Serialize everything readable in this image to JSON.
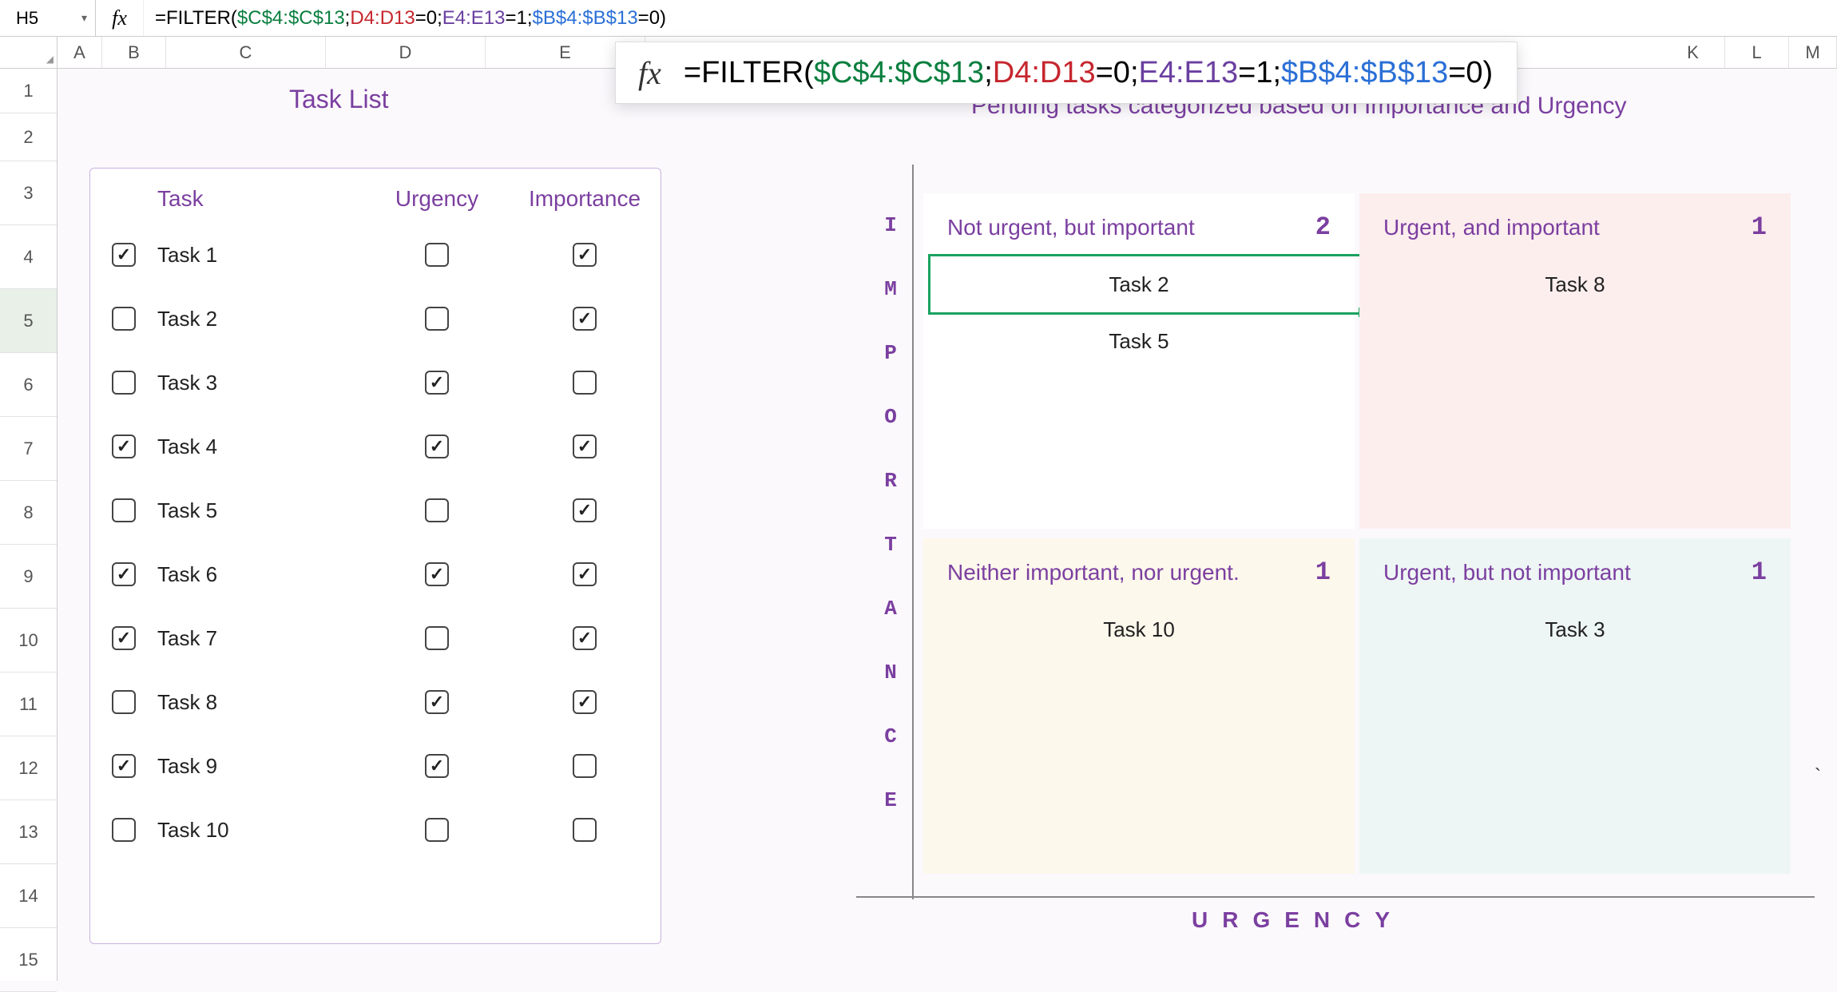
{
  "nameBox": "H5",
  "formulaBar": {
    "prefix": "=FILTER(",
    "r1": "$C$4:$C$13",
    "r2": "D4:D13",
    "v2": "=0",
    "r3": "E4:E13",
    "v3": "=1",
    "r4": "$B$4:$B$13",
    "v4": "=0)",
    "sep": ";"
  },
  "columns": [
    "A",
    "B",
    "C",
    "D",
    "E",
    "K",
    "L",
    "M"
  ],
  "rows": [
    "1",
    "2",
    "3",
    "4",
    "5",
    "6",
    "7",
    "8",
    "9",
    "10",
    "11",
    "12",
    "13",
    "14",
    "15"
  ],
  "selectedRow": "5",
  "taskList": {
    "title": "Task List",
    "headers": {
      "task": "Task",
      "urgency": "Urgency",
      "importance": "Importance"
    },
    "rows": [
      {
        "done": true,
        "name": "Task 1",
        "urgent": false,
        "important": true
      },
      {
        "done": false,
        "name": "Task 2",
        "urgent": false,
        "important": true
      },
      {
        "done": false,
        "name": "Task 3",
        "urgent": true,
        "important": false
      },
      {
        "done": true,
        "name": "Task 4",
        "urgent": true,
        "important": true
      },
      {
        "done": false,
        "name": "Task 5",
        "urgent": false,
        "important": true
      },
      {
        "done": true,
        "name": "Task 6",
        "urgent": true,
        "important": true
      },
      {
        "done": true,
        "name": "Task 7",
        "urgent": false,
        "important": true
      },
      {
        "done": false,
        "name": "Task 8",
        "urgent": true,
        "important": true
      },
      {
        "done": true,
        "name": "Task 9",
        "urgent": true,
        "important": false
      },
      {
        "done": false,
        "name": "Task 10",
        "urgent": false,
        "important": false
      }
    ]
  },
  "matrix": {
    "title": "Pending tasks categorized based on Importance and Urgency",
    "vAxis": [
      "I",
      "M",
      "P",
      "O",
      "R",
      "T",
      "A",
      "N",
      "C",
      "E"
    ],
    "hAxis": "URGENCY",
    "quads": {
      "q1": {
        "label": "Not urgent, but important",
        "count": "2",
        "items": [
          "Task 2",
          "Task 5"
        ]
      },
      "q2": {
        "label": "Urgent, and important",
        "count": "1",
        "items": [
          "Task 8"
        ]
      },
      "q3": {
        "label": "Neither important, nor urgent.",
        "count": "1",
        "items": [
          "Task 10"
        ]
      },
      "q4": {
        "label": "Urgent, but not important",
        "count": "1",
        "items": [
          "Task 3"
        ]
      }
    }
  },
  "stray": "`"
}
